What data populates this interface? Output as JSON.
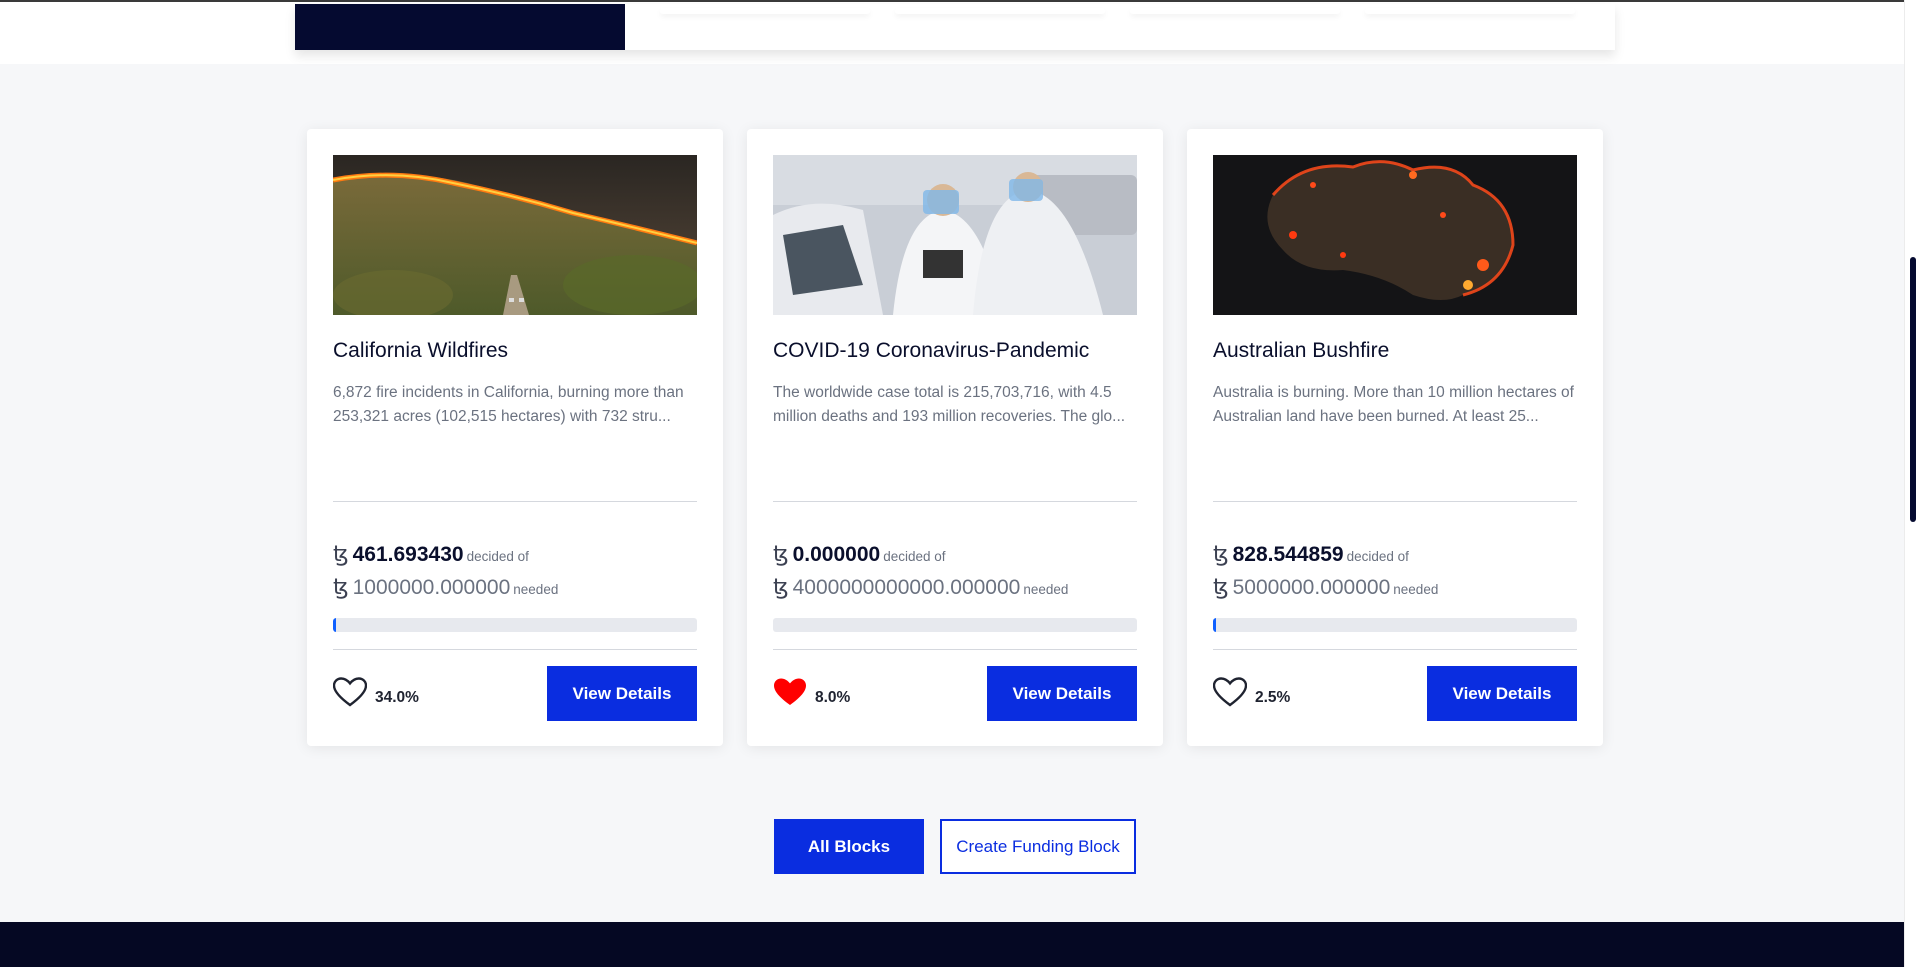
{
  "colors": {
    "accent": "#0a2de0",
    "navy": "#050a30",
    "progress": "#1060ff",
    "heart_liked": "#ff0000",
    "footer": "#050823"
  },
  "currency_symbol": "ꜩ",
  "cards": [
    {
      "title": "California Wildfires",
      "description": "6,872 fire incidents in California, burning more than 253,321 acres (102,515 hectares) with 732 stru...",
      "image_icon": "wildfire-photo",
      "decided_amount": "461.693430",
      "decided_label": "decided of",
      "needed_amount": "1000000.000000",
      "needed_label": "needed",
      "progress_fraction": 0.0005,
      "liked": false,
      "heart_icon": "heart-outline-icon",
      "percent": "34.0%",
      "button_label": "View Details"
    },
    {
      "title": "COVID-19 Coronavirus-Pandemic",
      "description": "The worldwide case total is 215,703,716, with 4.5 million deaths and 193 million recoveries. The glo...",
      "image_icon": "medical-workers-photo",
      "decided_amount": "0.000000",
      "decided_label": "decided of",
      "needed_amount": "4000000000000.000000",
      "needed_label": "needed",
      "progress_fraction": 0,
      "liked": true,
      "heart_icon": "heart-filled-icon",
      "percent": "8.0%",
      "button_label": "View Details"
    },
    {
      "title": "Australian Bushfire",
      "description": "Australia is burning. More than 10 million hectares of Australian land have been burned. At least 25...",
      "image_icon": "australia-fire-map-photo",
      "decided_amount": "828.544859",
      "decided_label": "decided of",
      "needed_amount": "5000000.000000",
      "needed_label": "needed",
      "progress_fraction": 0.0002,
      "liked": false,
      "heart_icon": "heart-outline-icon",
      "percent": "2.5%",
      "button_label": "View Details"
    }
  ],
  "actions": {
    "all_blocks_label": "All Blocks",
    "create_label": "Create Funding Block"
  }
}
